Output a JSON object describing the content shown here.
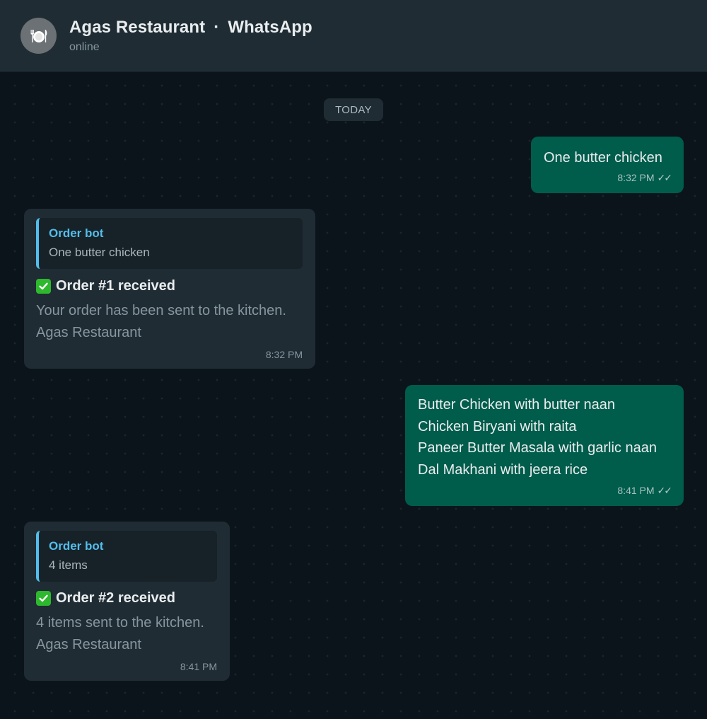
{
  "header": {
    "name": "Agas Restaurant",
    "separator": "·",
    "app": "WhatsApp",
    "status": "online",
    "avatar_icon": "plate-cutlery-icon"
  },
  "chat": {
    "date_label": "TODAY",
    "messages": [
      {
        "direction": "outgoing",
        "text": "One butter chicken",
        "time": "8:32 PM",
        "ticks": "✓✓"
      },
      {
        "direction": "incoming",
        "quote": {
          "author": "Order bot",
          "text": "One butter chicken"
        },
        "title": "Order #1 received",
        "lines": [
          "Your order has been sent to the kitchen.",
          "Agas Restaurant"
        ],
        "time": "8:32 PM"
      },
      {
        "direction": "outgoing",
        "lines": [
          "Butter Chicken with butter naan",
          "Chicken Biryani with raita",
          "Paneer Butter Masala with garlic naan",
          "Dal Makhani with jeera rice"
        ],
        "time": "8:41 PM",
        "ticks": "✓✓"
      },
      {
        "direction": "incoming",
        "quote": {
          "author": "Order bot",
          "text": "4 items"
        },
        "title": "Order #2 received",
        "lines": [
          "4 items sent to the kitchen.",
          "Agas Restaurant"
        ],
        "time": "8:41 PM"
      }
    ]
  },
  "colors": {
    "background": "#0b141a",
    "header": "#1f2c33",
    "outgoing_bubble": "#005c4b",
    "incoming_bubble": "#202c33",
    "quote_accent": "#53bdeb",
    "check_green": "#2eb82e"
  }
}
